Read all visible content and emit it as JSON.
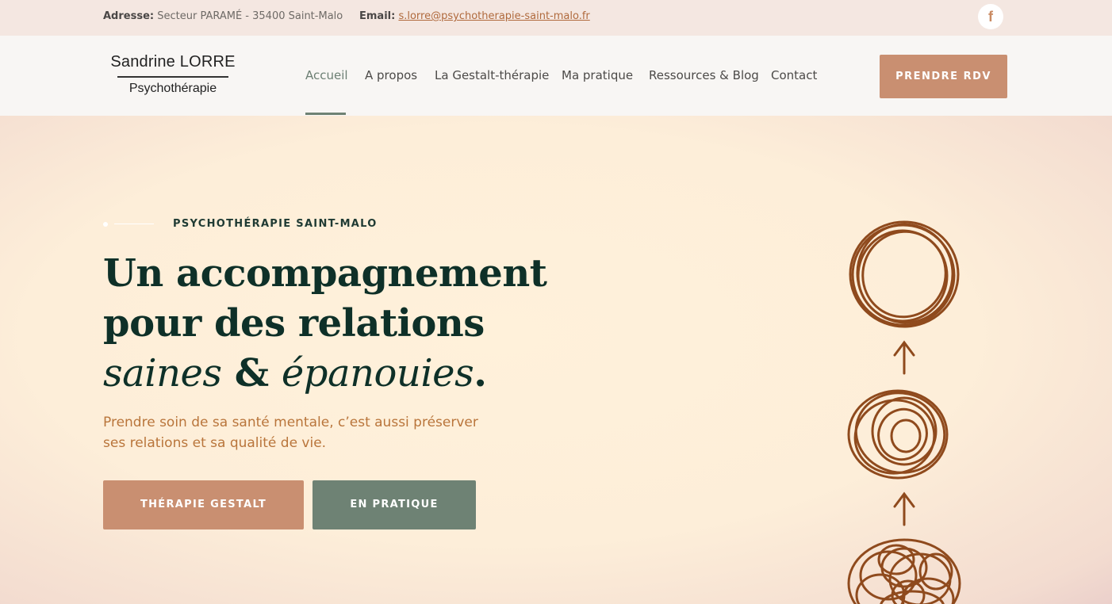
{
  "topbar": {
    "address_label": "Adresse:",
    "address_value": "Secteur PARAMÉ - 35400 Saint-Malo",
    "email_label": "Email:",
    "email_value": "s.lorre@psychotherapie-saint-malo.fr",
    "facebook_icon": "f"
  },
  "logo": {
    "name": "Sandrine LORRE",
    "subtitle": "Psychothérapie"
  },
  "nav": {
    "items": [
      {
        "label": "Accueil"
      },
      {
        "label": "A propos"
      },
      {
        "label": "La Gestalt-thérapie"
      },
      {
        "label": "Ma pratique"
      },
      {
        "label": "Ressources & Blog"
      },
      {
        "label": "Contact"
      }
    ],
    "cta": "PRENDRE RDV"
  },
  "hero": {
    "eyebrow": "PSYCHOTHÉRAPIE SAINT-MALO",
    "title_line1": "Un accompagnement",
    "title_line2": "pour des relations",
    "title_em1": "saines",
    "title_amp": "&",
    "title_em2": "épanouies",
    "title_dot": ".",
    "lead": "Prendre soin de sa santé mentale, c’est aussi préserver ses relations et sa qualité de vie.",
    "button_primary": "THÉRAPIE GESTALT",
    "button_secondary": "EN PRATIQUE"
  },
  "colors": {
    "accent": "#c98f71",
    "secondary": "#6e8274",
    "heading": "#0e3028",
    "scribble": "#8f4a1d"
  }
}
